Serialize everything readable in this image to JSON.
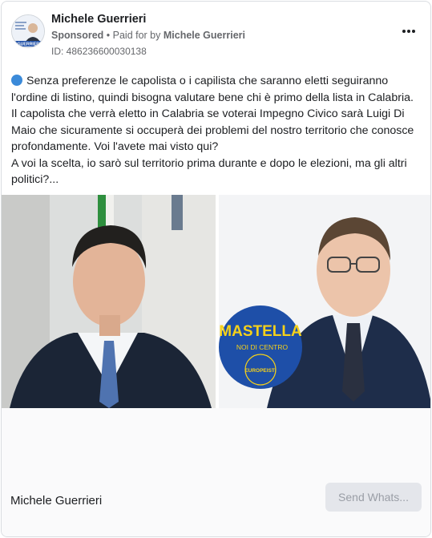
{
  "ad": {
    "page_name": "Michele Guerrieri",
    "sponsored_label": "Sponsored",
    "separator": " • ",
    "paid_for_prefix": "Paid for by ",
    "payer": "Michele Guerrieri",
    "ad_id": "ID: 486236600030138",
    "body_paragraph_1": "Senza preferenze le capolista o i capilista che saranno eletti seguiranno l'ordine di listino, quindi bisogna valutare bene chi è primo della lista in Calabria.",
    "body_paragraph_2": "Il capolista che verrà eletto in Calabria se voterai Impegno Civico sarà Luigi Di Maio che sicuramente si occuperà dei problemi del nostro territorio che conosce profondamente. Voi l'avete mai visto qui?",
    "body_paragraph_3": "A voi la scelta, io sarò sul territorio prima durante e dopo le elezioni, ma gli altri politici?...",
    "avatar_text": "GUERRIERI",
    "logo_line_1": "MASTELLA",
    "logo_line_2": "NOI DI CENTRO",
    "logo_line_3": "EUROPEISTI",
    "footer_name": "Michele Guerrieri",
    "cta_label": "Send Whats..."
  },
  "icons": {
    "more": "more-horizontal-icon",
    "bullet": "blue-circle-icon"
  },
  "colors": {
    "text": "#1c1e21",
    "secondary_text": "#65676b",
    "bullet_blue": "#3b8ad9",
    "cta_bg": "#e4e6eb",
    "cta_text": "#9a9ea6",
    "logo_blue": "#1e4fa8",
    "logo_yellow": "#f5d11a"
  }
}
